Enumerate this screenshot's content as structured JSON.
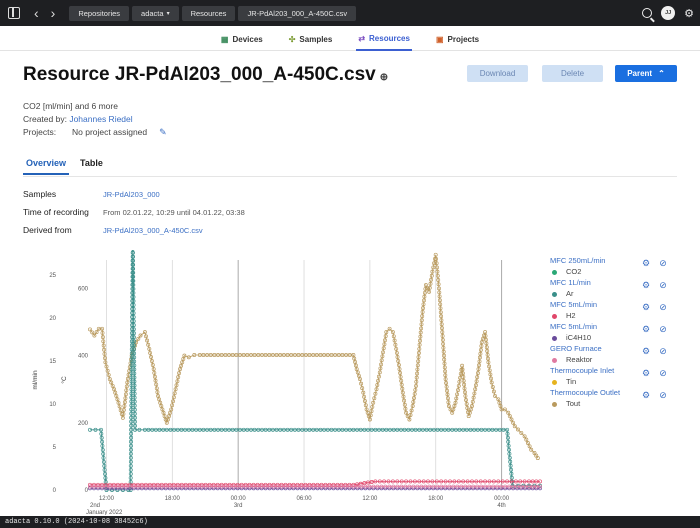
{
  "topbar": {
    "breadcrumbs": [
      "Repositories",
      "adacta",
      "Resources",
      "JR-PdAl203_000_A-450C.csv"
    ],
    "avatar_initials": "JJ"
  },
  "nav": {
    "tabs": [
      {
        "label": "Devices",
        "icon": "devices-icon",
        "active": false
      },
      {
        "label": "Samples",
        "icon": "samples-icon",
        "active": false
      },
      {
        "label": "Resources",
        "icon": "resources-icon",
        "active": true
      },
      {
        "label": "Projects",
        "icon": "projects-icon",
        "active": false
      }
    ]
  },
  "page": {
    "title": "Resource JR-PdAl203_000_A-450C.csv",
    "buttons": {
      "download": "Download",
      "delete": "Delete",
      "parent": "Parent"
    },
    "summary": "CO2 [ml/min] and 6 more",
    "created_by_label": "Created by:",
    "created_by": "Johannes Riedel",
    "projects_label": "Projects:",
    "projects_value": "No project assigned",
    "subtabs": [
      "Overview",
      "Table"
    ],
    "samples_label": "Samples",
    "samples_value": "JR-PdAl203_000",
    "recording_label": "Time of recording",
    "recording_value": "From 02.01.22, 10:29 until 04.01.22, 03:38",
    "derived_label": "Derived from",
    "derived_value": "JR-PdAl203_000_A-450C.csv"
  },
  "legend": [
    {
      "name": "MFC 250mL/min",
      "series": "CO2",
      "color": "#2aa876"
    },
    {
      "name": "MFC 1L/min",
      "series": "Ar",
      "color": "#3a8f8a"
    },
    {
      "name": "MFC 5mL/min",
      "series": "H2",
      "color": "#e0476a"
    },
    {
      "name": "MFC 5mL/min",
      "series": "iC4H10",
      "color": "#6a4c9c"
    },
    {
      "name": "GERO Furnace",
      "series": "Reaktor",
      "color": "#e07aa0"
    },
    {
      "name": "Thermocouple Inlet",
      "series": "Tin",
      "color": "#e6b31e"
    },
    {
      "name": "Thermocouple Outlet",
      "series": "Tout",
      "color": "#b99a5e"
    }
  ],
  "chart_data": {
    "type": "line",
    "ylabel_left": "ml/min",
    "ylabel_right": "°C",
    "y_left_ticks": [
      "25",
      "20",
      "15",
      "10",
      "5",
      "0"
    ],
    "y_right_ticks": [
      "600",
      "400",
      "200",
      "0"
    ],
    "x_ticks": [
      {
        "t": 1.5,
        "label": "12:00",
        "sub": ""
      },
      {
        "t": 7.5,
        "label": "18:00",
        "sub": ""
      },
      {
        "t": 13.5,
        "label": "00:00",
        "sub": "3rd"
      },
      {
        "t": 19.5,
        "label": "06:00",
        "sub": ""
      },
      {
        "t": 25.5,
        "label": "12:00",
        "sub": ""
      },
      {
        "t": 31.5,
        "label": "18:00",
        "sub": ""
      },
      {
        "t": 37.5,
        "label": "00:00",
        "sub": "4th"
      }
    ],
    "x_start_label": "2nd",
    "x_start_sub": "January 2022",
    "series": [
      {
        "name": "Tout",
        "color": "#b99a5e",
        "x": [
          0,
          0.4,
          0.8,
          1.1,
          1.4,
          1.8,
          2.2,
          2.6,
          3.0,
          3.4,
          3.8,
          4.2,
          4.6,
          5.0,
          5.4,
          5.8,
          6.2,
          6.6,
          7.0,
          7.4,
          7.8,
          8.2,
          8.6,
          9.0,
          9.5,
          10,
          11,
          12,
          13,
          14,
          15,
          16,
          17,
          18,
          19,
          20,
          21,
          22,
          23,
          24,
          24.3,
          24.6,
          24.9,
          25.2,
          25.5,
          25.8,
          26.1,
          26.4,
          26.7,
          27.0,
          27.3,
          27.6,
          27.9,
          28.2,
          28.5,
          28.8,
          29.1,
          29.4,
          29.7,
          30.0,
          30.3,
          30.6,
          30.9,
          31.2,
          31.5,
          31.8,
          32.1,
          32.4,
          32.7,
          33.0,
          33.3,
          33.6,
          33.9,
          34.2,
          34.5,
          34.8,
          35.1,
          35.4,
          35.7,
          36.0,
          36.3,
          36.6,
          36.9,
          37.2,
          37.5,
          37.8,
          38.1,
          38.4,
          38.7,
          39.0,
          39.3,
          39.6,
          39.9,
          40.2,
          40.5,
          40.8
        ],
        "y": [
          478,
          460,
          480,
          480,
          380,
          330,
          300,
          260,
          215,
          320,
          400,
          440,
          460,
          470,
          420,
          360,
          280,
          240,
          200,
          240,
          300,
          360,
          400,
          395,
          402,
          402,
          402,
          402,
          402,
          402,
          402,
          402,
          402,
          402,
          402,
          402,
          402,
          402,
          402,
          402,
          360,
          330,
          290,
          240,
          210,
          260,
          300,
          350,
          410,
          470,
          480,
          470,
          420,
          360,
          290,
          230,
          210,
          250,
          310,
          420,
          530,
          610,
          590,
          650,
          700,
          600,
          470,
          330,
          250,
          230,
          260,
          310,
          370,
          280,
          220,
          250,
          300,
          360,
          440,
          470,
          380,
          320,
          280,
          270,
          240,
          240,
          230,
          210,
          190,
          180,
          170,
          160,
          140,
          120,
          110,
          95
        ]
      },
      {
        "name": "Ar",
        "color": "#3a8f8a",
        "x": [
          0,
          0.5,
          1.0,
          1.5,
          2.0,
          2.5,
          3.0,
          3.5,
          3.7,
          3.9,
          4.1,
          4.5,
          5,
          6,
          7,
          8,
          9,
          10,
          11,
          12,
          13,
          14,
          15,
          16,
          17,
          18,
          19,
          20,
          21,
          22,
          23,
          24,
          25,
          26,
          27,
          28,
          29,
          30,
          31,
          32,
          33,
          34,
          35,
          36,
          37,
          38,
          38.5,
          39,
          39.5,
          40,
          40.5,
          41
        ],
        "y": [
          7,
          7,
          7,
          0,
          0,
          0,
          0,
          0,
          0,
          29,
          7,
          7,
          7,
          7,
          7,
          7,
          7,
          7,
          7,
          7,
          7,
          7,
          7,
          7,
          7,
          7,
          7,
          7,
          7,
          7,
          7,
          7,
          7,
          7,
          7,
          7,
          7,
          7,
          7,
          7,
          7,
          7,
          7,
          7,
          7,
          7,
          0.5,
          0.5,
          0.5,
          0.5,
          0.5,
          0.5
        ]
      },
      {
        "name": "H2",
        "color": "#e0476a",
        "x": [
          0,
          4,
          8,
          12,
          16,
          20,
          24,
          26,
          28,
          30,
          32,
          34,
          36,
          38,
          40,
          41
        ],
        "y": [
          0.6,
          0.6,
          0.6,
          0.6,
          0.6,
          0.6,
          0.6,
          1.0,
          1.0,
          1.0,
          1.0,
          1.0,
          1.0,
          1.0,
          1.0,
          1.0
        ]
      },
      {
        "name": "iC4H10",
        "color": "#6a4c9c",
        "x": [
          0,
          4,
          8,
          12,
          16,
          20,
          24,
          28,
          32,
          36,
          40,
          41
        ],
        "y": [
          0.2,
          0.2,
          0.2,
          0.2,
          0.2,
          0.2,
          0.2,
          0.2,
          0.2,
          0.2,
          0.2,
          0.2
        ]
      },
      {
        "name": "Reaktor",
        "color": "#e07aa0",
        "x": [
          0,
          4,
          8,
          12,
          16,
          20,
          24,
          28,
          32,
          36,
          40,
          41
        ],
        "y": [
          0.4,
          0.4,
          0.4,
          0.4,
          0.4,
          0.4,
          0.4,
          0.4,
          0.4,
          0.4,
          0.4,
          0.4
        ]
      }
    ]
  }
}
